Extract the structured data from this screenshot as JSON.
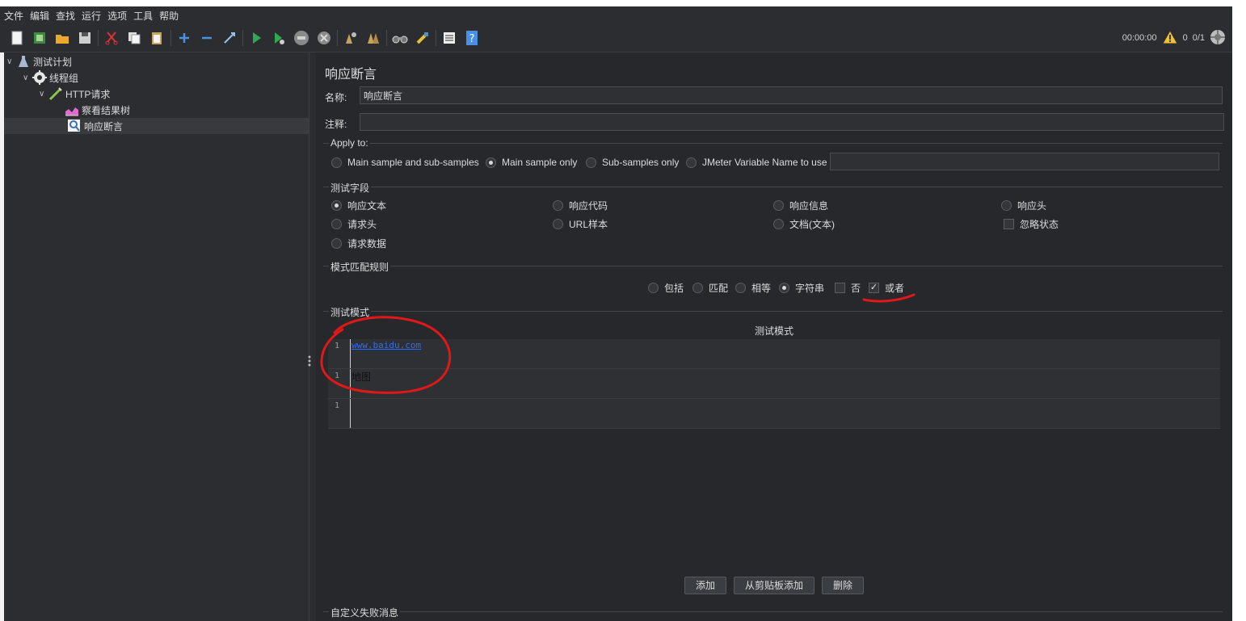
{
  "menu": [
    "文件",
    "编辑",
    "查找",
    "运行",
    "选项",
    "工具",
    "帮助"
  ],
  "toolbar": {
    "icons": [
      "new-icon",
      "template-icon",
      "open-icon",
      "save-icon",
      "cut-icon",
      "copy-icon",
      "paste-icon",
      "expand-icon",
      "collapse-icon",
      "toggle-icon",
      "start-icon",
      "start-no-pause-icon",
      "stop-icon",
      "shutdown-icon",
      "clear-icon",
      "clear-all-icon",
      "search-icon",
      "reset-search-icon",
      "function-helper-icon",
      "help-icon"
    ]
  },
  "status": {
    "timer": "00:00:00",
    "warnings": "0",
    "threads": "0/1"
  },
  "tree": {
    "items": [
      {
        "label": "测试计划",
        "icon": "test-plan-icon"
      },
      {
        "label": "线程组",
        "icon": "thread-group-icon"
      },
      {
        "label": "HTTP请求",
        "icon": "http-request-icon"
      },
      {
        "label": "察看结果树",
        "icon": "results-tree-icon"
      },
      {
        "label": "响应断言",
        "icon": "response-assertion-icon"
      }
    ]
  },
  "panel": {
    "title": "响应断言",
    "name_label": "名称:",
    "name_value": "响应断言",
    "comment_label": "注释:",
    "comment_value": "",
    "apply_to": {
      "title": "Apply to:",
      "options": [
        "Main sample and sub-samples",
        "Main sample only",
        "Sub-samples only",
        "JMeter Variable Name to use"
      ],
      "selected": "Main sample only",
      "variable_value": ""
    },
    "test_field": {
      "title": "测试字段",
      "options": [
        "响应文本",
        "响应代码",
        "响应信息",
        "响应头",
        "请求头",
        "URL样本",
        "文档(文本)",
        "忽略状态",
        "请求数据"
      ],
      "selected": "响应文本",
      "ignore_status_checked": false
    },
    "match_rules": {
      "title": "模式匹配规则",
      "options": [
        "包括",
        "匹配",
        "相等",
        "字符串",
        "否",
        "或者"
      ],
      "selected": "字符串",
      "not_checked": false,
      "or_checked": true
    },
    "patterns": {
      "title": "测试模式",
      "column_header": "测试模式",
      "rows": [
        {
          "line": "1",
          "text": "www.baidu.com"
        },
        {
          "line": "1",
          "text": "地图"
        },
        {
          "line": "1",
          "text": ""
        }
      ]
    },
    "buttons": {
      "add": "添加",
      "add_clipboard": "从剪贴板添加",
      "delete": "删除"
    },
    "failure_message_title": "自定义失败消息"
  }
}
